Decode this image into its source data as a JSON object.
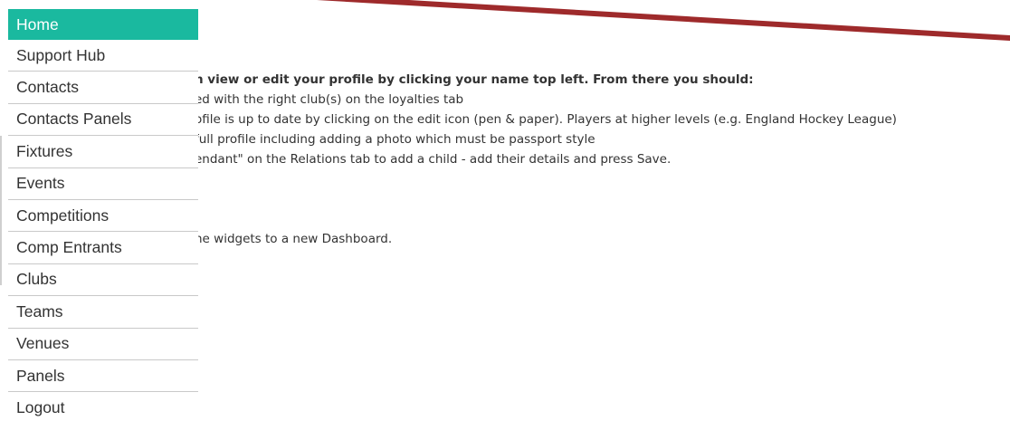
{
  "menu": {
    "items": [
      {
        "label": "Home",
        "active": true
      },
      {
        "label": "Support Hub"
      },
      {
        "label": "Contacts"
      },
      {
        "label": "Contacts Panels"
      },
      {
        "label": "Fixtures"
      },
      {
        "label": "Events"
      },
      {
        "label": "Competitions"
      },
      {
        "label": "Comp Entrants"
      },
      {
        "label": "Clubs"
      },
      {
        "label": "Teams"
      },
      {
        "label": "Venues"
      },
      {
        "label": "Panels"
      },
      {
        "label": "Logout"
      }
    ]
  },
  "content": {
    "intro": "n view or edit your profile by clicking your name top left. From there you should:",
    "line1": "ed with the right club(s) on the loyalties tab",
    "line2": "ofile is up to date by clicking on the edit icon (pen & paper). Players at higher levels (e.g. England Hockey League)",
    "line3": "full profile including adding a photo which must be passport style",
    "line4": "endant\" on the Relations tab to add a child - add their details and press Save.",
    "line5": "he widgets to a new Dashboard."
  },
  "colors": {
    "accent": "#1ab99f",
    "annotation_stroke": "#9e2a2b",
    "text": "#333333",
    "divider": "#c9c9c9"
  }
}
